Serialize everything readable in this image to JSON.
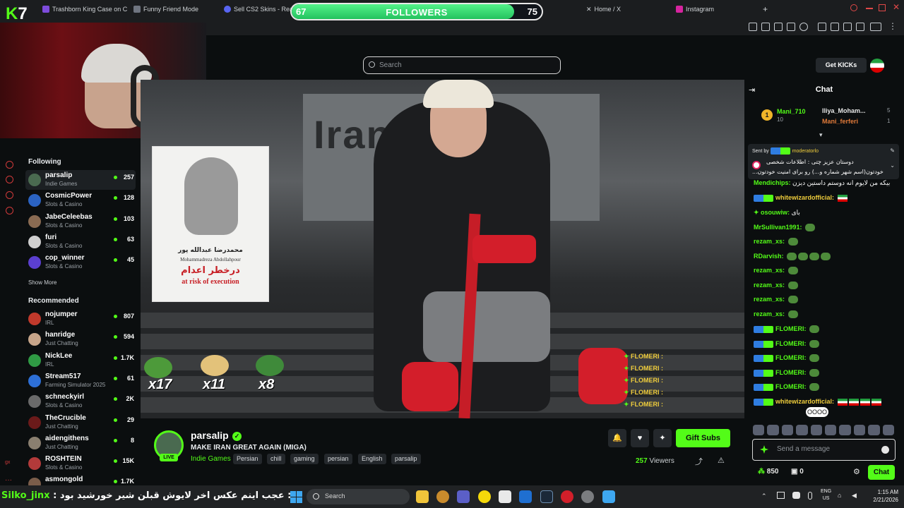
{
  "browser": {
    "tabs": [
      {
        "label": "Trashborn King Case on C"
      },
      {
        "label": "Funny Friend Mode"
      },
      {
        "label": "Sell CS2 Skins - Real"
      },
      {
        "label": "Home / X"
      },
      {
        "label": "Instagram"
      }
    ],
    "new_tab": "+"
  },
  "followers_widget": {
    "current": "67",
    "title": "FOLLOWERS",
    "goal": "75",
    "progress": 0.89
  },
  "logo": {
    "k": "K",
    "num": "7"
  },
  "search": {
    "placeholder": "Search"
  },
  "sidebar": {
    "following_title": "Following",
    "following": [
      {
        "name": "parsalip",
        "category": "Indie Games",
        "viewers": "257",
        "color": "#4a6a50"
      },
      {
        "name": "CosmicPower",
        "category": "Slots & Casino",
        "viewers": "128",
        "color": "#2b63c2"
      },
      {
        "name": "JabeCeleebas",
        "category": "Slots & Casino",
        "viewers": "103",
        "color": "#8a6b52"
      },
      {
        "name": "furi",
        "category": "Slots & Casino",
        "viewers": "63",
        "color": "#cfcfcf"
      },
      {
        "name": "cop_winner",
        "category": "Slots & Casino",
        "viewers": "45",
        "color": "#5b3fd0"
      }
    ],
    "show_more": "Show More",
    "recommended_title": "Recommended",
    "recommended": [
      {
        "name": "nojumper",
        "category": "IRL",
        "viewers": "807",
        "color": "#c0392b"
      },
      {
        "name": "hanridge",
        "category": "Just Chatting",
        "viewers": "594",
        "color": "#c7a58a"
      },
      {
        "name": "NickLee",
        "category": "IRL",
        "viewers": "1.7K",
        "color": "#2f9a44"
      },
      {
        "name": "Stream517",
        "category": "Farming Simulator 2025",
        "viewers": "61",
        "color": "#2d6fd6"
      },
      {
        "name": "schneckyirl",
        "category": "Slots & Casino",
        "viewers": "2K",
        "color": "#6a6a6a"
      },
      {
        "name": "TheCrucible",
        "category": "Just Chatting",
        "viewers": "29",
        "color": "#6b1a1a"
      },
      {
        "name": "aidengithens",
        "category": "Just Chatting",
        "viewers": "8",
        "color": "#8a7f70"
      },
      {
        "name": "ROSHTEIN",
        "category": "Slots & Casino",
        "viewers": "15K",
        "color": "#b33a3a"
      },
      {
        "name": "asmongold",
        "category": "",
        "viewers": "1.7K",
        "color": "#7a5d4a"
      }
    ]
  },
  "poster": {
    "name_fa": "محمدرضا عبدالله پور",
    "name_en": "Mohammadreza Abdollahpour",
    "risk_fa": "درخطر اعدام",
    "risk_en": "at risk of execution"
  },
  "video_overlay": {
    "iran_text": "Iran",
    "emote_counts": [
      "x17",
      "x11",
      "x8"
    ],
    "chat_lines": [
      "FLOMERI :",
      "FLOMERI :",
      "FLOMERI :",
      "FLOMERI :",
      "FLOMERI :"
    ]
  },
  "stream": {
    "name": "parsalip",
    "live": "LIVE",
    "title": "MAKE IRAN GREAT AGAIN (MIGA)",
    "category": "Indie Games",
    "tags": [
      "Persian",
      "chill",
      "gaming",
      "persian",
      "English",
      "parsalip"
    ],
    "gift_button": "Gift Subs",
    "viewers": "257",
    "viewers_label": "Viewers"
  },
  "chat": {
    "get_kicks": "Get KICKs",
    "title": "Chat",
    "leaderboard": [
      {
        "rank": "1",
        "name": "Mani_710",
        "score": "10"
      },
      {
        "name": "Iliya_Moham...",
        "score": "5"
      },
      {
        "name": "Mani_ferferi",
        "score": "1"
      }
    ],
    "pinned": {
      "sent_by": "Sent by",
      "author": "moderatorlo",
      "line1": "دوستان عزیز چتی : اطلاعات شخصی",
      "line2": "...خودتون(اسم شهر شماره و...) رو برای امنیت خودتون"
    },
    "messages": [
      {
        "user": "Mendichips:",
        "text": "بیکه من لایوم انه دوستم داستین دیزن"
      },
      {
        "user": "whitewizardofficial:",
        "text": ""
      },
      {
        "user": "osouwiw:",
        "text": "بای"
      },
      {
        "user": "MrSullivan1991:",
        "text": ""
      },
      {
        "user": "rezam_xs:",
        "text": ""
      },
      {
        "user": "RDarvish:",
        "text": ""
      },
      {
        "user": "rezam_xs:",
        "text": ""
      },
      {
        "user": "rezam_xs:",
        "text": ""
      },
      {
        "user": "rezam_xs:",
        "text": ""
      },
      {
        "user": "rezam_xs:",
        "text": ""
      },
      {
        "user": "FLOMERI:",
        "text": ""
      },
      {
        "user": "FLOMERI:",
        "text": ""
      },
      {
        "user": "FLOMERI:",
        "text": ""
      },
      {
        "user": "FLOMERI:",
        "text": ""
      },
      {
        "user": "FLOMERI:",
        "text": ""
      },
      {
        "user": "whitewizardofficial:",
        "text": ""
      }
    ],
    "tooltip": "OOOO",
    "input_placeholder": "Send a message",
    "kicks": "850",
    "subs": "0",
    "chat_button": "Chat"
  },
  "marquee": {
    "user": "Silko_jinx",
    "text": "عجب اینم عکس اخر لایوش قبلن شیر خورشید بود :"
  },
  "taskbar": {
    "search": "Search",
    "lang_top": "ENG",
    "lang_bottom": "US",
    "time": "1:15 AM",
    "date": "2/21/2026"
  },
  "colors": {
    "accent": "#53fc18",
    "background": "#0b0e0f"
  }
}
